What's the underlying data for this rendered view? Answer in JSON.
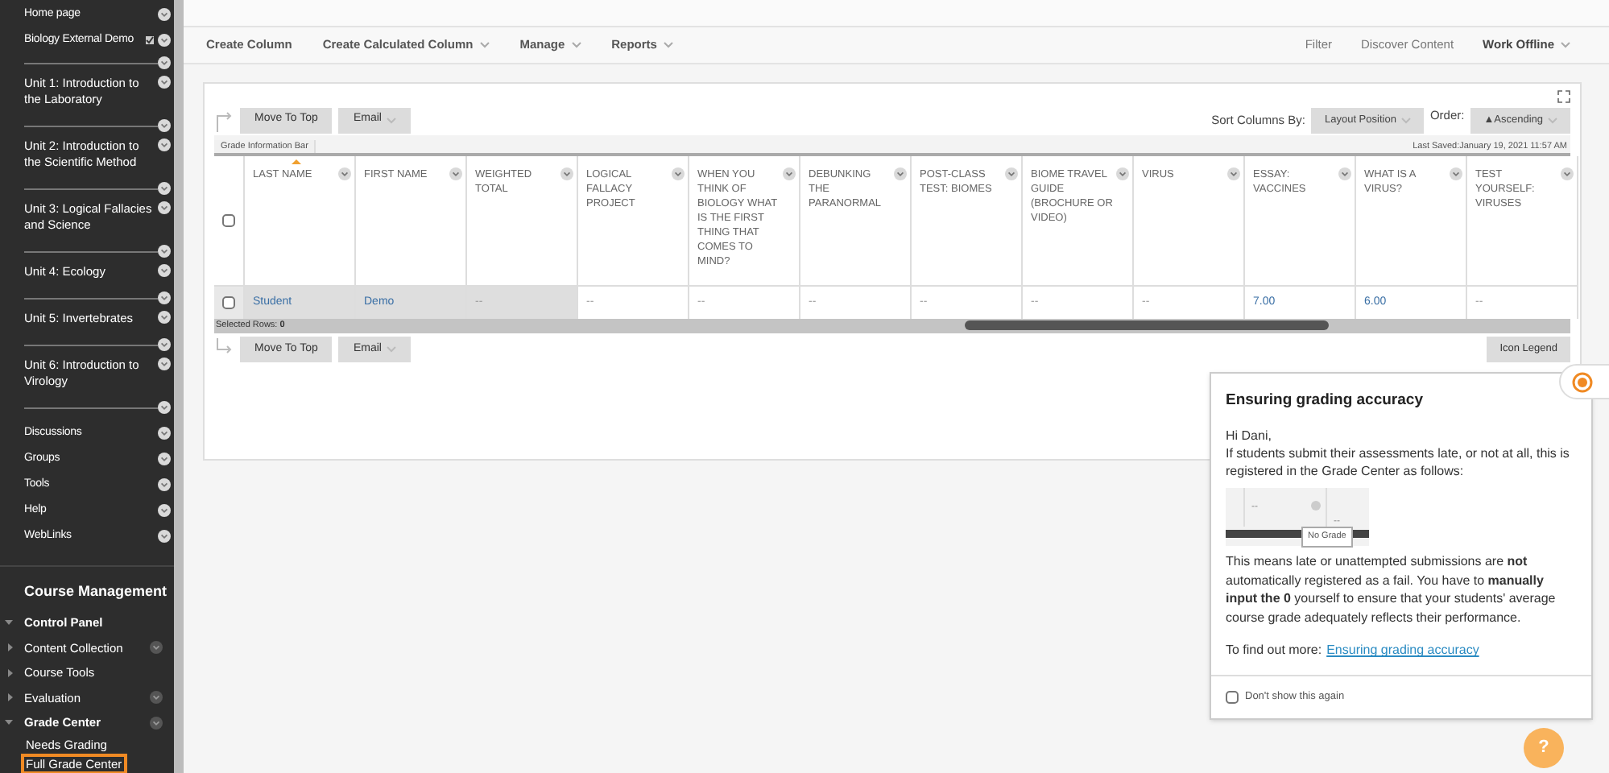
{
  "sidebar": {
    "items": [
      {
        "label": "Home page",
        "kind": "link",
        "badge": false
      },
      {
        "label": "Biology External Demo",
        "kind": "link",
        "badge": true
      },
      {
        "label": "Unit 1: Introduction to the Laboratory",
        "kind": "unit",
        "badge": false
      },
      {
        "label": "Unit 2: Introduction to the Scientific Method",
        "kind": "unit",
        "badge": false
      },
      {
        "label": "Unit 3: Logical Fallacies and Science",
        "kind": "unit",
        "badge": false
      },
      {
        "label": "Unit 4: Ecology",
        "kind": "unit",
        "badge": false
      },
      {
        "label": "Unit 5: Invertebrates",
        "kind": "unit",
        "badge": false
      },
      {
        "label": "Unit 6: Introduction to Virology",
        "kind": "unit",
        "badge": false
      },
      {
        "label": "Discussions",
        "kind": "spaced",
        "badge": false
      },
      {
        "label": "Groups",
        "kind": "link",
        "badge": false
      },
      {
        "label": "Tools",
        "kind": "link",
        "badge": false
      },
      {
        "label": "Help",
        "kind": "link",
        "badge": false
      },
      {
        "label": "WebLinks",
        "kind": "link",
        "badge": false
      }
    ]
  },
  "course_management": {
    "title": "Course Management",
    "items": [
      {
        "label": "Control Panel",
        "expanded": true,
        "menu": false,
        "children": [
          {
            "label": "Content Collection",
            "expanded": false,
            "menu": true
          },
          {
            "label": "Course Tools",
            "expanded": false,
            "menu": false
          },
          {
            "label": "Evaluation",
            "expanded": false,
            "menu": true
          },
          {
            "label": "Grade Center",
            "expanded": true,
            "menu": true,
            "children": [
              {
                "label": "Needs Grading",
                "selected": false
              },
              {
                "label": "Full Grade Center",
                "selected": true
              }
            ]
          }
        ]
      }
    ]
  },
  "toolbar": {
    "left": [
      {
        "label": "Create Column",
        "dropdown": false,
        "bold": true
      },
      {
        "label": "Create Calculated Column",
        "dropdown": true,
        "bold": true
      },
      {
        "label": "Manage",
        "dropdown": true,
        "bold": true
      },
      {
        "label": "Reports",
        "dropdown": true,
        "bold": true
      }
    ],
    "right": [
      {
        "label": "Filter",
        "dropdown": false,
        "bold": false
      },
      {
        "label": "Discover Content",
        "dropdown": false,
        "bold": false
      },
      {
        "label": "Work Offline",
        "dropdown": true,
        "bold": true
      }
    ]
  },
  "grid": {
    "select_all": {
      "checked": false
    },
    "top_buttons": [
      {
        "label": "Move To Top",
        "dropdown": false
      },
      {
        "label": "Email",
        "dropdown": true
      }
    ],
    "sort_label": "Sort Columns By:",
    "sort_value": "Layout Position",
    "order_label": "Order:",
    "order_value": "▲Ascending",
    "info_bar": "Grade Information Bar",
    "last_saved": "Last Saved:January 19, 2021 11:57 AM",
    "columns": [
      {
        "label": "LAST NAME",
        "sorted": true,
        "frozen": true
      },
      {
        "label": "FIRST NAME",
        "sorted": false,
        "frozen": true
      },
      {
        "label": "WEIGHTED TOTAL",
        "sorted": false,
        "frozen": true
      },
      {
        "label": "LOGICAL FALLACY PROJECT",
        "sorted": false,
        "frozen": false
      },
      {
        "label": "WHEN YOU THINK OF BIOLOGY WHAT IS THE FIRST THING THAT COMES TO MIND?",
        "sorted": false,
        "frozen": false
      },
      {
        "label": "DEBUNKING THE PARANORMAL",
        "sorted": false,
        "frozen": false
      },
      {
        "label": "POST-CLASS TEST: BIOMES",
        "sorted": false,
        "frozen": false
      },
      {
        "label": "BIOME TRAVEL GUIDE (BROCHURE OR VIDEO)",
        "sorted": false,
        "frozen": false
      },
      {
        "label": "VIRUS",
        "sorted": false,
        "frozen": false
      },
      {
        "label": "ESSAY: VACCINES",
        "sorted": false,
        "frozen": false
      },
      {
        "label": "WHAT IS A VIRUS?",
        "sorted": false,
        "frozen": false
      },
      {
        "label": "TEST YOURSELF: VIRUSES",
        "sorted": false,
        "frozen": false
      }
    ],
    "rows": [
      {
        "selected": false,
        "cells": [
          {
            "text": "Student",
            "kind": "link"
          },
          {
            "text": "Demo",
            "kind": "link"
          },
          {
            "text": "--",
            "kind": "empty"
          },
          {
            "text": "--",
            "kind": "empty"
          },
          {
            "text": "--",
            "kind": "empty"
          },
          {
            "text": "--",
            "kind": "empty"
          },
          {
            "text": "--",
            "kind": "empty"
          },
          {
            "text": "--",
            "kind": "empty"
          },
          {
            "text": "--",
            "kind": "empty"
          },
          {
            "text": "7.00",
            "kind": "link"
          },
          {
            "text": "6.00",
            "kind": "link"
          },
          {
            "text": "--",
            "kind": "empty"
          }
        ]
      }
    ],
    "selected_rows": "Selected Rows: **0**",
    "bottom_buttons": [
      {
        "label": "Move To Top",
        "dropdown": false
      },
      {
        "label": "Email",
        "dropdown": true
      }
    ],
    "legend_button": "Icon Legend"
  },
  "popup": {
    "title": "Ensuring grading accuracy",
    "greeting": "Hi Dani,",
    "intro": "If students submit their assessments late, or not at all, this is registered in the Grade Center as follows:",
    "example_cells": [
      "--",
      "--"
    ],
    "example_tooltip": "No Grade",
    "body": "This means late or unattempted submissions are **not** automatically registered as a fail. You have to **manually input the 0** yourself to ensure that your students' average course grade adequately reflects their performance.",
    "more_label": "To find out more:",
    "more_link": "Ensuring grading accuracy",
    "dont_show": {
      "label": "Don't show this again",
      "checked": false
    }
  },
  "help_button": "?"
}
